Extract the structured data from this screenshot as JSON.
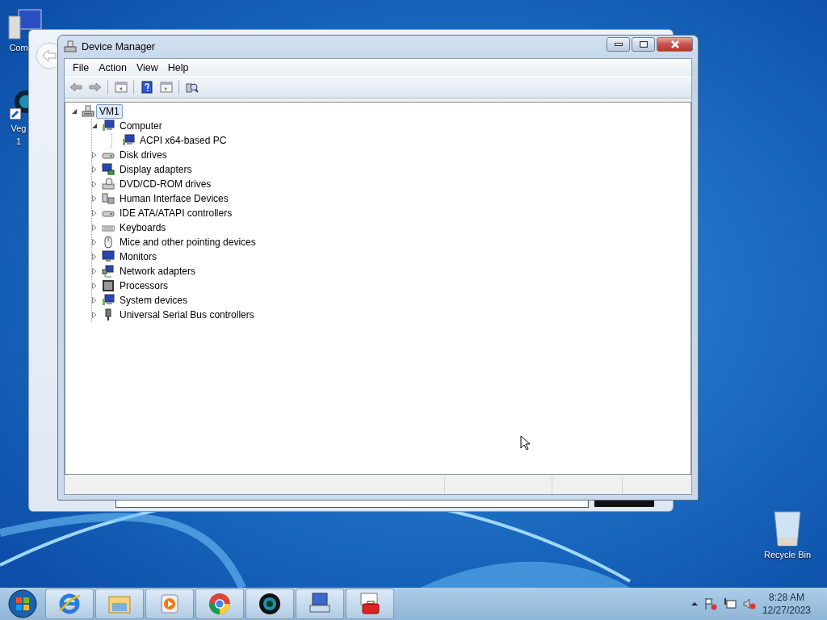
{
  "desktop_icons": [
    {
      "kind": "computer",
      "lines": [
        "Com"
      ]
    },
    {
      "kind": "lens",
      "lines": [
        "Veg",
        "1"
      ]
    },
    {
      "kind": "recycle",
      "lines": [
        "Recycle Bin"
      ]
    }
  ],
  "window": {
    "title": "Device Manager",
    "menu": [
      "File",
      "Action",
      "View",
      "Help"
    ],
    "toolbar": [
      {
        "kind": "back",
        "disabled": true
      },
      {
        "kind": "forward",
        "disabled": true
      },
      {
        "kind": "separator"
      },
      {
        "kind": "console-tree",
        "disabled": false
      },
      {
        "kind": "separator"
      },
      {
        "kind": "help",
        "disabled": false
      },
      {
        "kind": "action-pane",
        "disabled": false
      },
      {
        "kind": "separator"
      },
      {
        "kind": "scan",
        "disabled": false
      }
    ],
    "tree": [
      {
        "label": "VM1",
        "kind": "computer",
        "selected": true,
        "expanded": true,
        "children": [
          {
            "label": "Computer",
            "kind": "system",
            "selected": false,
            "expanded": true,
            "children": [
              {
                "label": "ACPI x64-based PC",
                "kind": "system",
                "selected": false
              }
            ]
          },
          {
            "label": "Disk drives",
            "kind": "disk",
            "selected": false,
            "expanded": false
          },
          {
            "label": "Display adapters",
            "kind": "display",
            "selected": false,
            "expanded": false
          },
          {
            "label": "DVD/CD-ROM drives",
            "kind": "dvd",
            "selected": false,
            "expanded": false
          },
          {
            "label": "Human Interface Devices",
            "kind": "hid",
            "selected": false,
            "expanded": false
          },
          {
            "label": "IDE ATA/ATAPI controllers",
            "kind": "disk",
            "selected": false,
            "expanded": false
          },
          {
            "label": "Keyboards",
            "kind": "keyboard",
            "selected": false,
            "expanded": false
          },
          {
            "label": "Mice and other pointing devices",
            "kind": "mouse",
            "selected": false,
            "expanded": false
          },
          {
            "label": "Monitors",
            "kind": "monitor",
            "selected": false,
            "expanded": false
          },
          {
            "label": "Network adapters",
            "kind": "network",
            "selected": false,
            "expanded": false
          },
          {
            "label": "Processors",
            "kind": "cpu",
            "selected": false,
            "expanded": false
          },
          {
            "label": "System devices",
            "kind": "system",
            "selected": false,
            "expanded": false
          },
          {
            "label": "Universal Serial Bus controllers",
            "kind": "usb",
            "selected": false,
            "expanded": false
          }
        ]
      }
    ]
  },
  "taskbar": {
    "apps": [
      {
        "kind": "ie"
      },
      {
        "kind": "folder"
      },
      {
        "kind": "media"
      },
      {
        "kind": "chrome"
      },
      {
        "kind": "lens"
      },
      {
        "kind": "remote"
      },
      {
        "kind": "toolbox"
      }
    ],
    "tray": [
      {
        "kind": "arrow"
      },
      {
        "kind": "flag"
      },
      {
        "kind": "network"
      },
      {
        "kind": "speaker"
      }
    ],
    "time": "8:28 AM",
    "date": "12/27/2023"
  }
}
